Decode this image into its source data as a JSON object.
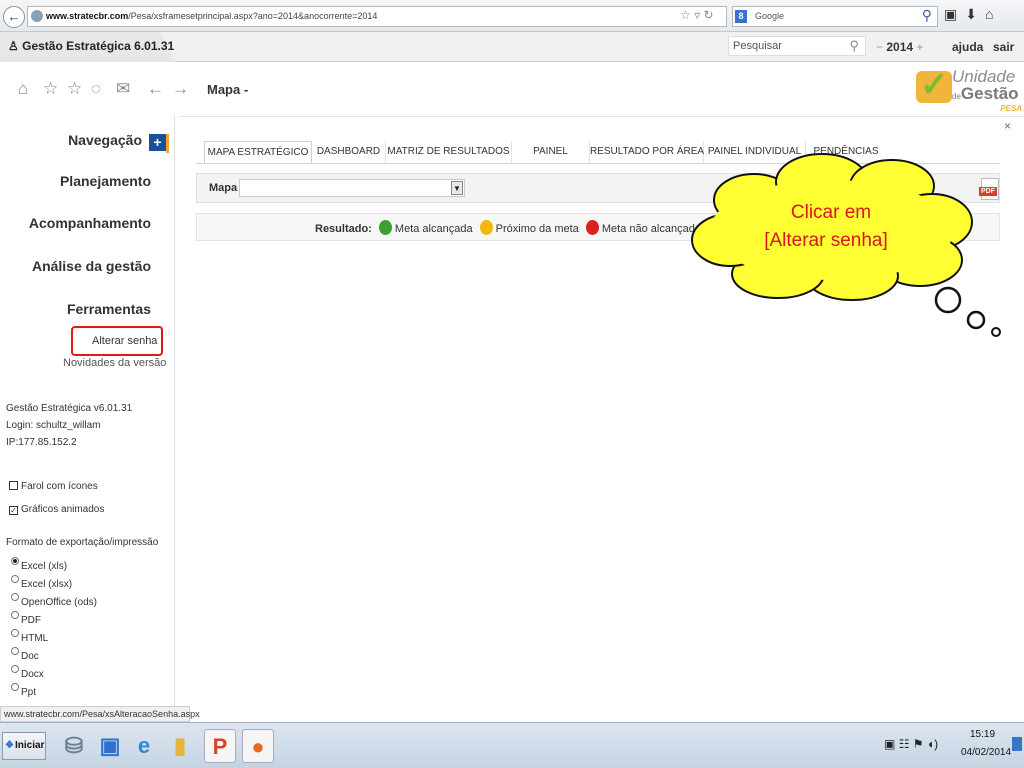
{
  "browser": {
    "url_domain": "www.stratecbr.com",
    "url_path": "/Pesa/xsframesetprincipal.aspx?ano=2014&anocorrente=2014",
    "search_placeholder": "Google",
    "search_engine_letter": "8"
  },
  "app": {
    "title": "Gestão Estratégica 6.01.31",
    "search_placeholder": "Pesquisar",
    "year_prev": "−",
    "year": "2014",
    "year_next": "+",
    "help": "ajuda",
    "logout": "sair",
    "page_title": "Mapa -"
  },
  "logo": {
    "line1": "Unidade",
    "line2_prefix": "de",
    "line2": "Gestão",
    "line3": "PESA"
  },
  "sidebar": {
    "nav_header": "Navegação",
    "nav_plus": "+",
    "items": [
      "Planejamento",
      "Acompanhamento",
      "Análise da gestão",
      "Ferramentas"
    ],
    "sub_items": [
      "Alterar senha",
      "Novidades da versão"
    ],
    "info": [
      "Gestão Estratégica v6.01.31",
      "Login: schultz_willam",
      "IP:177.85.152.2"
    ],
    "checkboxes": [
      {
        "label": "Farol com ícones",
        "checked": false
      },
      {
        "label": "Gráficos animados",
        "checked": true
      }
    ],
    "export_title": "Formato de exportação/impressão",
    "export_options": [
      {
        "label": "Excel (xls)",
        "selected": true
      },
      {
        "label": "Excel (xlsx)",
        "selected": false
      },
      {
        "label": "OpenOffice (ods)",
        "selected": false
      },
      {
        "label": "PDF",
        "selected": false
      },
      {
        "label": "HTML",
        "selected": false
      },
      {
        "label": "Doc",
        "selected": false
      },
      {
        "label": "Docx",
        "selected": false
      },
      {
        "label": "Ppt",
        "selected": false
      }
    ]
  },
  "main": {
    "close": "×",
    "tabs": [
      "MAPA ESTRATÉGICO",
      "DASHBOARD",
      "MATRIZ DE RESULTADOS",
      "PAINEL",
      "RESULTADO POR ÁREA",
      "PAINEL INDIVIDUAL",
      "PENDÊNCIAS"
    ],
    "active_tab": "MAPA ESTRATÉGICO",
    "map_label": "Mapa",
    "map_value": "",
    "pdf_label": "PDF",
    "result_label": "Resultado:",
    "legend": [
      {
        "label": "Meta alcançada",
        "color": "#3aa02f"
      },
      {
        "label": "Próximo da meta",
        "color": "#f2b80a"
      },
      {
        "label": "Meta não alcançada",
        "color": "#d9231c"
      },
      {
        "label": "",
        "color": "#1f5fc0"
      }
    ]
  },
  "callout": {
    "line1": "Clicar em",
    "line2": "[Alterar senha]",
    "fill": "#ffff33",
    "text_color": "#d8161c"
  },
  "statusbar": {
    "text": "www.stratecbr.com/Pesa/xsAlteracaoSenha.aspx"
  },
  "taskbar": {
    "start": "Iniciar",
    "time": "15:19",
    "date": "04/02/2014"
  }
}
